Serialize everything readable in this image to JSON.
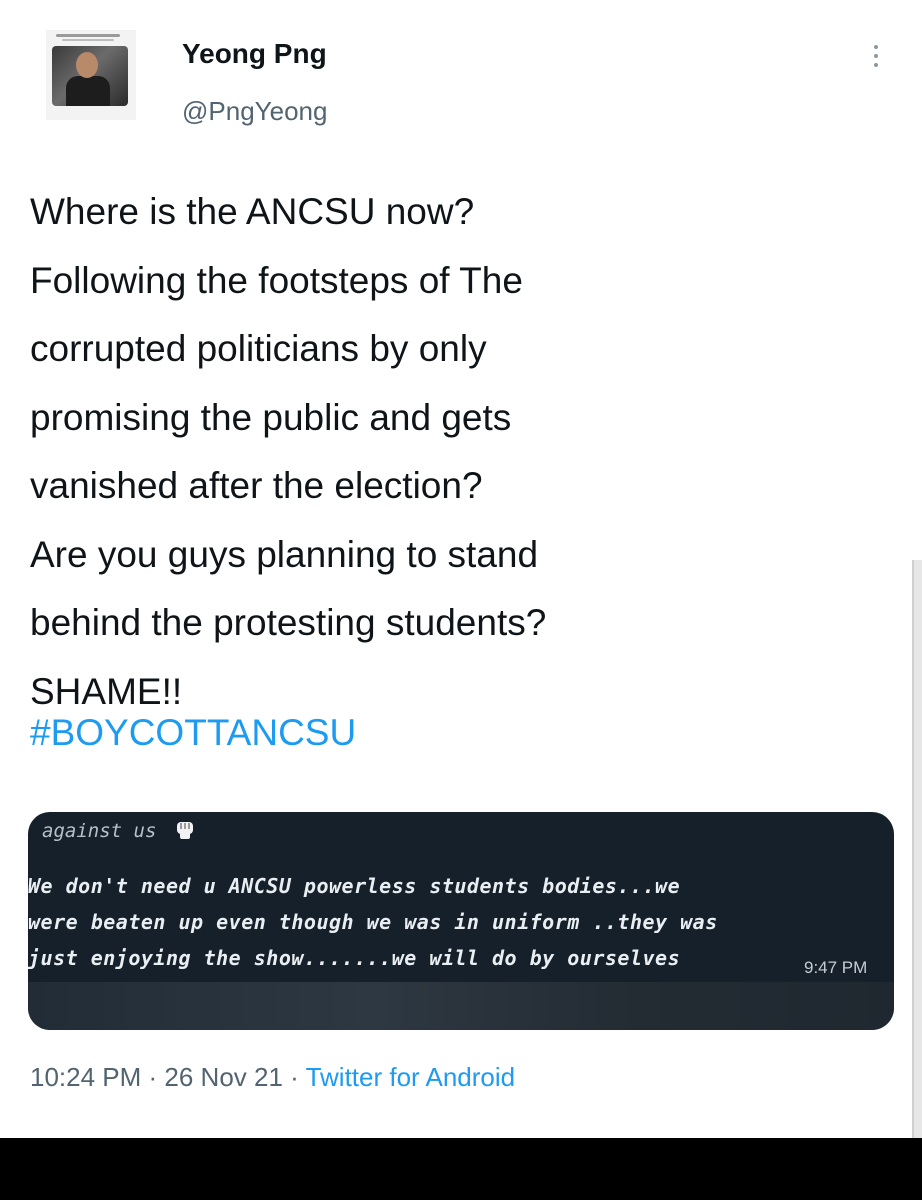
{
  "user": {
    "display_name": "Yeong Png",
    "handle": "@PngYeong"
  },
  "tweet": {
    "text": "Where is the ANCSU now?\nFollowing the footsteps of The\ncorrupted  politicians by only\npromising the public and gets\nvanished after the election?\nAre you guys planning to stand\nbehind the protesting students?\nSHAME!!",
    "hashtag": "#BOYCOTTANCSU"
  },
  "media": {
    "header": "against us",
    "lines": [
      "We don't need u ANCSU powerless students bodies...we",
      "were beaten up even though we was in uniform ..they was",
      "just enjoying the show.......we will do by ourselves"
    ],
    "time": "9:47 PM"
  },
  "meta": {
    "time": "10:24 PM",
    "sep1": " · ",
    "date": "26 Nov 21",
    "sep2": " · ",
    "source": "Twitter for Android"
  },
  "icons": {
    "more": "more-vertical-icon",
    "fist": "raised-fist-icon"
  },
  "colors": {
    "link": "#1d9bf0",
    "secondary_text": "#536471",
    "media_background": "#15202b"
  }
}
